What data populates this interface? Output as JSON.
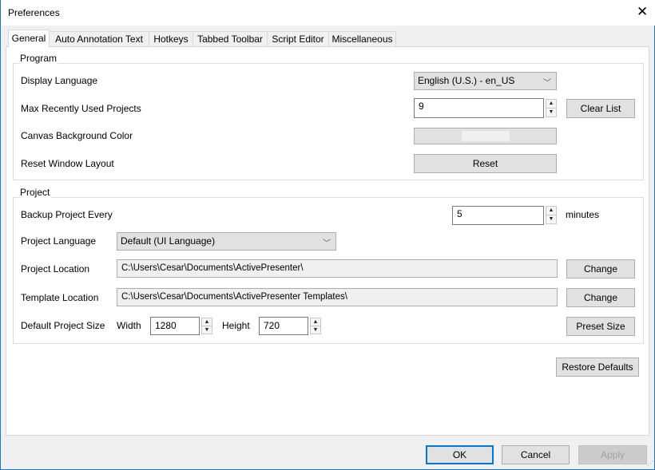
{
  "window": {
    "title": "Preferences",
    "close_icon": "close-icon"
  },
  "tabs": [
    {
      "label": "General",
      "selected": true
    },
    {
      "label": "Auto Annotation Text"
    },
    {
      "label": "Hotkeys"
    },
    {
      "label": "Tabbed Toolbar"
    },
    {
      "label": "Script Editor"
    },
    {
      "label": "Miscellaneous"
    }
  ],
  "program": {
    "legend": "Program",
    "display_language": {
      "label": "Display Language",
      "value": "English (U.S.) - en_US"
    },
    "max_recent": {
      "label": "Max Recently Used Projects",
      "value": "9",
      "clear_label": "Clear List"
    },
    "canvas_bg": {
      "label": "Canvas Background Color",
      "color": "#f0f0f0"
    },
    "reset_layout": {
      "label": "Reset Window Layout",
      "button": "Reset"
    }
  },
  "project": {
    "legend": "Project",
    "backup": {
      "label": "Backup Project Every",
      "value": "5",
      "unit": "minutes"
    },
    "language": {
      "label": "Project Language",
      "value": "Default (UI Language)"
    },
    "location": {
      "label": "Project Location",
      "value": "C:\\Users\\Cesar\\Documents\\ActivePresenter\\",
      "button": "Change"
    },
    "template": {
      "label": "Template Location",
      "value": "C:\\Users\\Cesar\\Documents\\ActivePresenter Templates\\",
      "button": "Change"
    },
    "size": {
      "label": "Default Project Size",
      "width_label": "Width",
      "width": "1280",
      "height_label": "Height",
      "height": "720",
      "button": "Preset Size"
    }
  },
  "restore_defaults": "Restore Defaults",
  "footer": {
    "ok": "OK",
    "cancel": "Cancel",
    "apply": "Apply"
  }
}
